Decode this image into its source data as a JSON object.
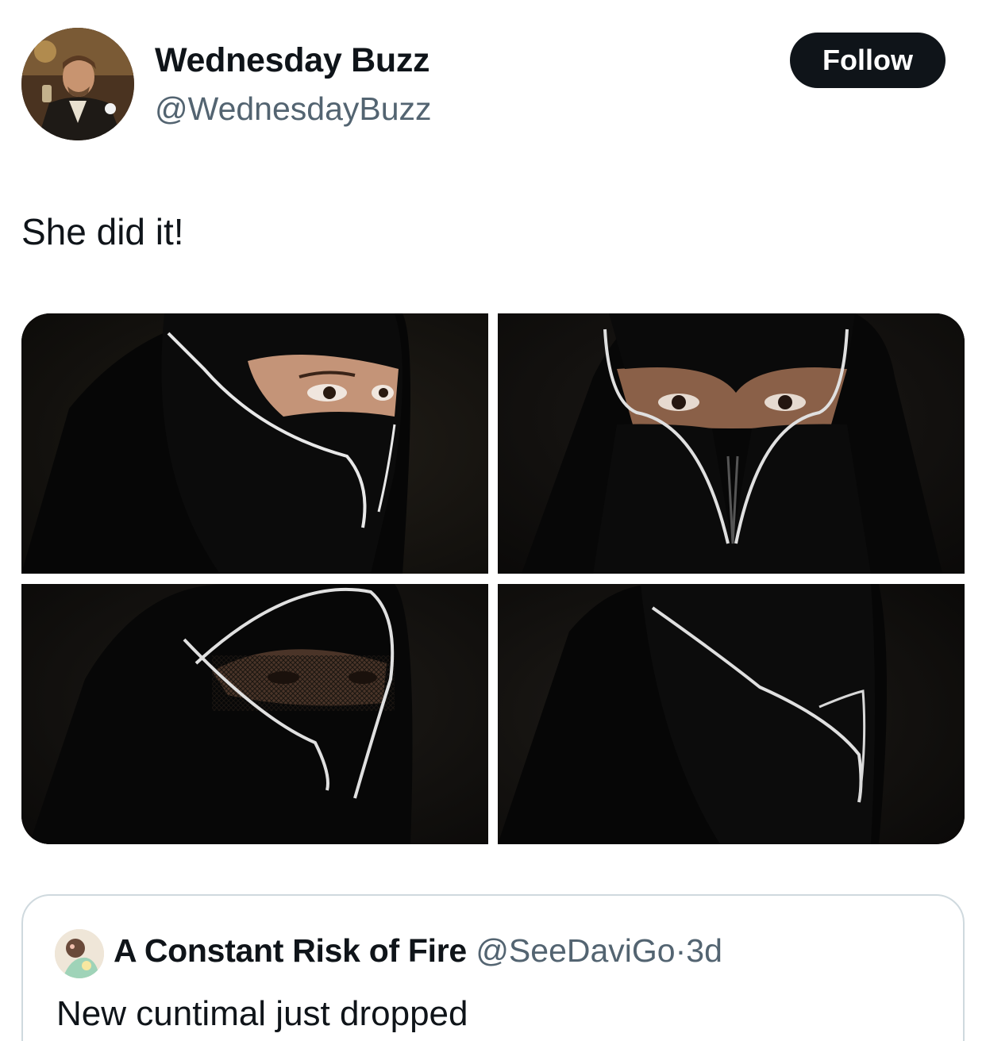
{
  "post": {
    "author": {
      "display_name": "Wednesday Buzz",
      "handle": "@WednesdayBuzz"
    },
    "follow_label": "Follow",
    "text": "She did it!",
    "media_count": 4
  },
  "quoted_post": {
    "author": {
      "display_name": "A Constant Risk of Fire",
      "handle": "@SeeDaviGo"
    },
    "separator": "·",
    "time": "3d",
    "text": "New cuntimal just dropped"
  },
  "colors": {
    "text_primary": "#0f1419",
    "text_secondary": "#536471",
    "button_bg": "#0f1419",
    "card_border": "#cfd9de",
    "background": "#ffffff"
  }
}
